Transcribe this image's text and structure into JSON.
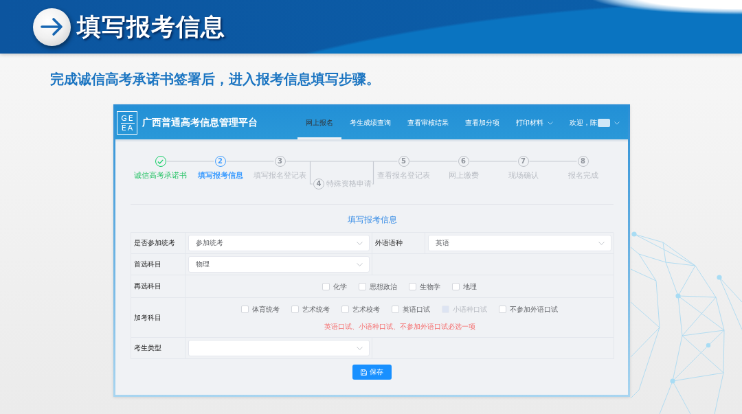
{
  "banner": {
    "title": "填写报考信息"
  },
  "subtitle": "完成诚信高考承诺书签署后，进入报考信息填写步骤。",
  "app": {
    "logo": [
      "GE",
      "EA"
    ],
    "title": "广西普通高考信息管理平台",
    "nav": [
      {
        "label": "网上报名",
        "kind": "link",
        "selected": true,
        "dropdown": false
      },
      {
        "label": "考生成绩查询",
        "kind": "link",
        "selected": false,
        "dropdown": false
      },
      {
        "label": "查看审核结果",
        "kind": "link",
        "selected": false,
        "dropdown": false
      },
      {
        "label": "查看加分项",
        "kind": "link",
        "selected": false,
        "dropdown": false
      },
      {
        "label": "打印材料",
        "kind": "link",
        "selected": false,
        "dropdown": true
      },
      {
        "label": "欢迎，陈",
        "kind": "user",
        "selected": false,
        "dropdown": true
      }
    ],
    "steps": [
      {
        "label": "诚信高考承诺书",
        "kind": "main",
        "done": true,
        "selected": false
      },
      {
        "number": "2",
        "label": "填写报考信息",
        "kind": "main",
        "done": false,
        "selected": true
      },
      {
        "number": "3",
        "label": "填写报名登记表",
        "kind": "main",
        "done": false,
        "selected": false
      },
      {
        "number": "4",
        "label": "特殊资格申请",
        "kind": "branch",
        "done": false,
        "selected": false
      },
      {
        "number": "5",
        "label": "查看报名登记表",
        "kind": "main",
        "done": false,
        "selected": false
      },
      {
        "number": "6",
        "label": "网上缴费",
        "kind": "main",
        "done": false,
        "selected": false
      },
      {
        "number": "7",
        "label": "现场确认",
        "kind": "main",
        "done": false,
        "selected": false
      },
      {
        "number": "8",
        "label": "报名完成",
        "kind": "main",
        "done": false,
        "selected": false
      }
    ]
  },
  "form": {
    "title": "填写报考信息",
    "rows": [
      {
        "kind": "select",
        "fields": [
          {
            "label": "是否参加统考",
            "value": "参加统考"
          },
          {
            "label": "外语语种",
            "value": "英语"
          }
        ]
      },
      {
        "kind": "select",
        "fields": [
          {
            "label": "首选科目",
            "value": "物理"
          }
        ]
      },
      {
        "kind": "checkboxes",
        "label": "再选科目",
        "options": [
          {
            "label": "化学",
            "checked": false,
            "disabled": false
          },
          {
            "label": "思想政治",
            "checked": false,
            "disabled": false
          },
          {
            "label": "生物学",
            "checked": false,
            "disabled": false
          },
          {
            "label": "地理",
            "checked": false,
            "disabled": false
          }
        ]
      },
      {
        "kind": "checkboxes",
        "label": "加考科目",
        "options": [
          {
            "label": "体育统考",
            "checked": false,
            "disabled": false
          },
          {
            "label": "艺术统考",
            "checked": false,
            "disabled": false
          },
          {
            "label": "艺术校考",
            "checked": false,
            "disabled": false
          },
          {
            "label": "英语口试",
            "checked": false,
            "disabled": false
          },
          {
            "label": "小语种口试",
            "checked": false,
            "disabled": true
          },
          {
            "label": "不参加外语口试",
            "checked": false,
            "disabled": false
          }
        ],
        "hint": "英语口试、小语种口试、不参加外语口试必选一项"
      },
      {
        "kind": "select",
        "fields": [
          {
            "label": "考生类型"
          }
        ]
      }
    ],
    "save_button": {
      "label": "保存"
    }
  }
}
